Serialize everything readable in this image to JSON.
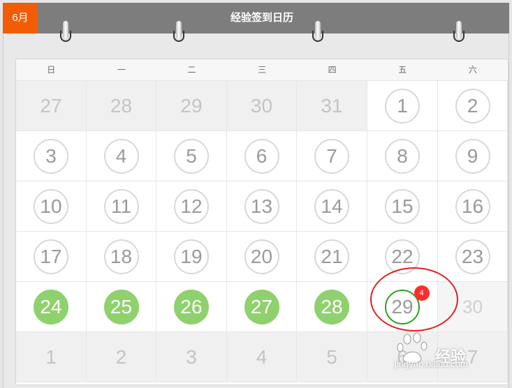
{
  "header": {
    "month_label": "6月",
    "title": "经验签到日历"
  },
  "weekdays": [
    "日",
    "一",
    "二",
    "三",
    "四",
    "五",
    "六"
  ],
  "rows": [
    [
      {
        "day": "27",
        "type": "prev"
      },
      {
        "day": "28",
        "type": "prev"
      },
      {
        "day": "29",
        "type": "prev"
      },
      {
        "day": "30",
        "type": "prev"
      },
      {
        "day": "31",
        "type": "prev"
      },
      {
        "day": "1",
        "type": "unsigned"
      },
      {
        "day": "2",
        "type": "unsigned"
      }
    ],
    [
      {
        "day": "3",
        "type": "unsigned"
      },
      {
        "day": "4",
        "type": "unsigned"
      },
      {
        "day": "5",
        "type": "unsigned"
      },
      {
        "day": "6",
        "type": "unsigned"
      },
      {
        "day": "7",
        "type": "unsigned"
      },
      {
        "day": "8",
        "type": "unsigned"
      },
      {
        "day": "9",
        "type": "unsigned"
      }
    ],
    [
      {
        "day": "10",
        "type": "unsigned"
      },
      {
        "day": "11",
        "type": "unsigned"
      },
      {
        "day": "12",
        "type": "unsigned"
      },
      {
        "day": "13",
        "type": "unsigned"
      },
      {
        "day": "14",
        "type": "unsigned"
      },
      {
        "day": "15",
        "type": "unsigned"
      },
      {
        "day": "16",
        "type": "unsigned"
      }
    ],
    [
      {
        "day": "17",
        "type": "unsigned"
      },
      {
        "day": "18",
        "type": "unsigned"
      },
      {
        "day": "19",
        "type": "unsigned"
      },
      {
        "day": "20",
        "type": "unsigned"
      },
      {
        "day": "21",
        "type": "unsigned"
      },
      {
        "day": "22",
        "type": "unsigned"
      },
      {
        "day": "23",
        "type": "unsigned"
      }
    ],
    [
      {
        "day": "24",
        "type": "signed"
      },
      {
        "day": "25",
        "type": "signed"
      },
      {
        "day": "26",
        "type": "signed"
      },
      {
        "day": "27",
        "type": "signed"
      },
      {
        "day": "28",
        "type": "signed"
      },
      {
        "day": "29",
        "type": "today",
        "badge": "4"
      },
      {
        "day": "30",
        "type": "future"
      }
    ],
    [
      {
        "day": "1",
        "type": "next"
      },
      {
        "day": "2",
        "type": "next"
      },
      {
        "day": "3",
        "type": "next"
      },
      {
        "day": "4",
        "type": "next"
      },
      {
        "day": "5",
        "type": "next"
      },
      {
        "day": "6",
        "type": "next"
      },
      {
        "day": "7",
        "type": "next"
      }
    ]
  ],
  "colors": {
    "month_badge": "#f25c05",
    "header_bar": "#7d7d7d",
    "signed_fill": "#8fd16d",
    "today_ring": "#2aa21c",
    "badge": "#ff2d2d",
    "annotation_oval": "#e02020"
  },
  "watermark": {
    "brand": "Bai度",
    "label": "经验",
    "url": "jingyan.baidu.com"
  }
}
